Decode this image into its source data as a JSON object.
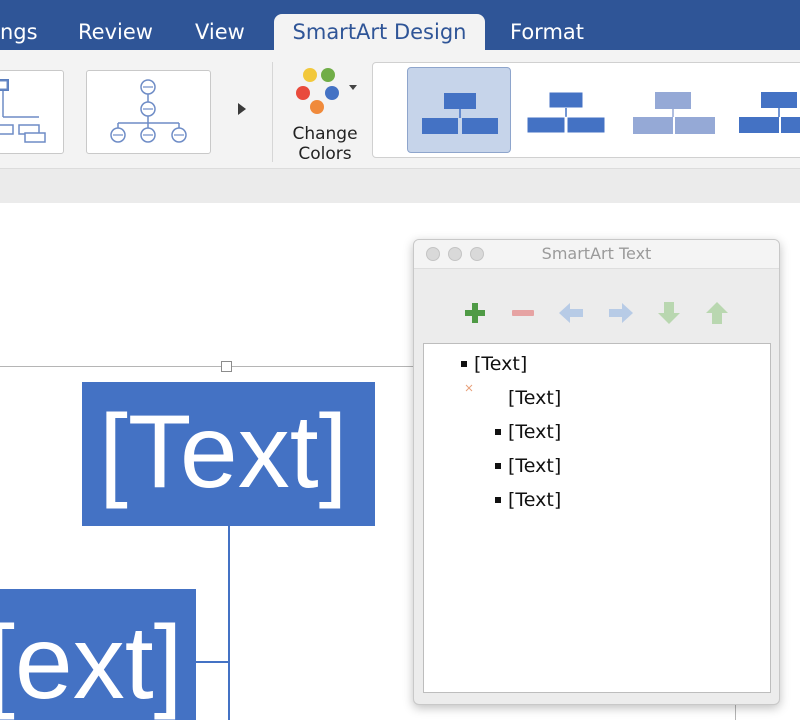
{
  "tabs": [
    {
      "label": "ngs"
    },
    {
      "label": "Review"
    },
    {
      "label": "View"
    },
    {
      "label": "SmartArt Design",
      "active": true
    },
    {
      "label": "Format"
    }
  ],
  "ribbon": {
    "change_colors_line1": "Change",
    "change_colors_line2": "Colors",
    "colors": {
      "accent": "#4472c4",
      "tab_bar": "#2f5597",
      "dot_yellow": "#f2c83b",
      "dot_green": "#70ad47",
      "dot_red": "#e94b3c",
      "dot_blue": "#4472c4",
      "dot_orange": "#f08a3b"
    }
  },
  "canvas": {
    "top_box_text": "[Text]",
    "left_box_text": "[ext]"
  },
  "text_pane": {
    "title": "SmartArt Text",
    "items": [
      {
        "text": "[Text]",
        "bullet": true
      },
      {
        "text": "[Text]",
        "bullet": false
      },
      {
        "text": "[Text]",
        "bullet": true
      },
      {
        "text": "[Text]",
        "bullet": true
      },
      {
        "text": "[Text]",
        "bullet": true
      }
    ]
  }
}
